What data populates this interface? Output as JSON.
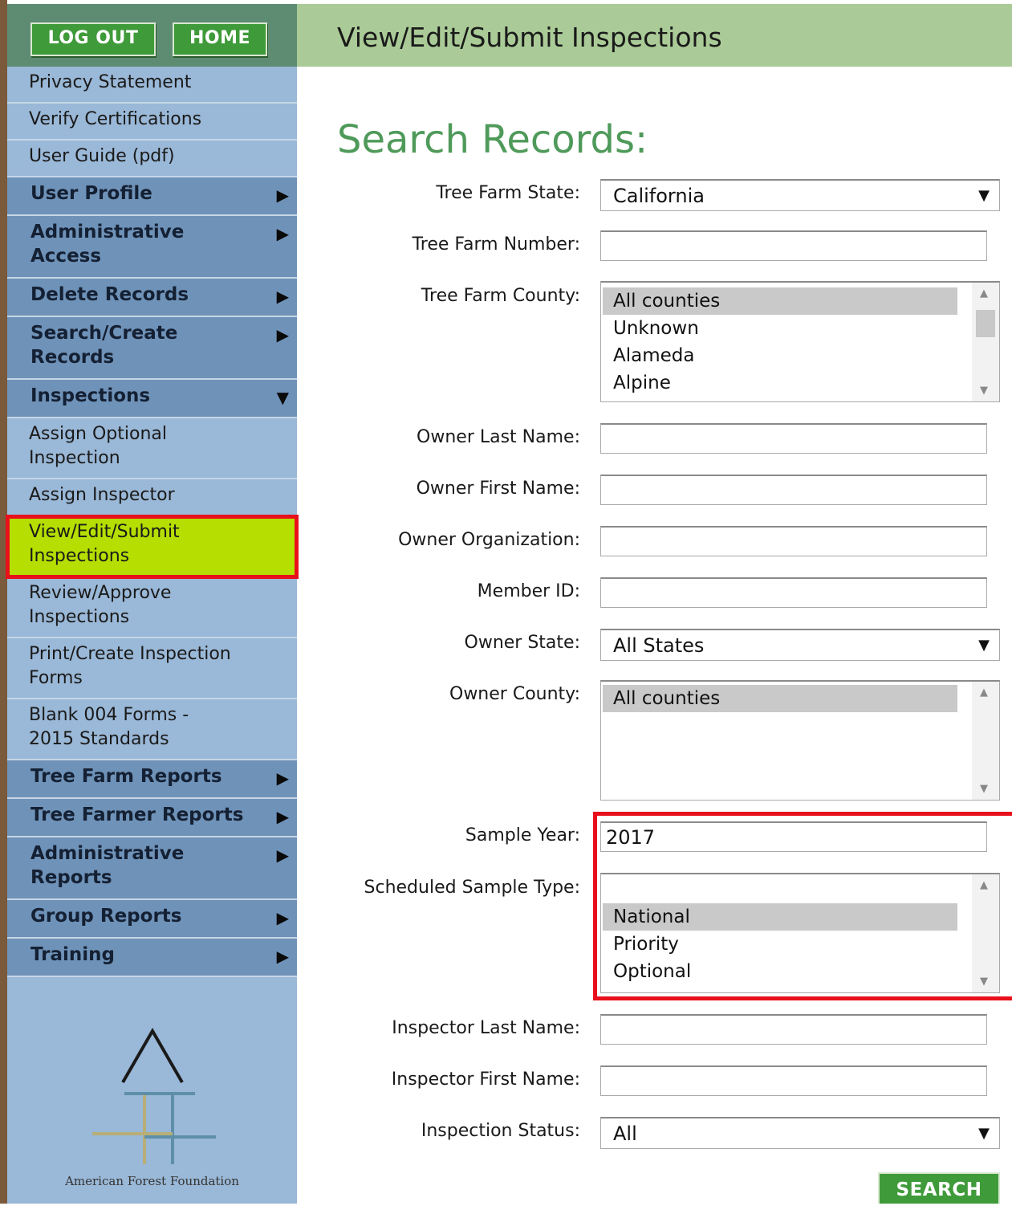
{
  "topbar": {
    "logout_label": "LOG OUT",
    "home_label": "HOME"
  },
  "header": {
    "title": "View/Edit/Submit Inspections"
  },
  "sidebar": {
    "links": [
      "Privacy Statement",
      "Verify Certifications",
      "User Guide (pdf)"
    ],
    "categories": {
      "user_profile": "User Profile",
      "administrative_access": [
        "Administrative",
        "Access"
      ],
      "delete_records": "Delete Records",
      "search_create": [
        "Search/Create",
        "Records"
      ],
      "inspections": "Inspections",
      "tree_farm_reports": "Tree Farm Reports",
      "tree_farmer_reports": "Tree Farmer Reports",
      "administrative_reports": [
        "Administrative",
        "Reports"
      ],
      "group_reports": "Group Reports",
      "training": "Training"
    },
    "arrows": {
      "collapsed": "▶",
      "expanded": "▼"
    },
    "inspection_items": {
      "assign_optional": [
        "Assign Optional",
        "Inspection"
      ],
      "assign_inspector": "Assign Inspector",
      "view_edit_submit": [
        "View/Edit/Submit",
        "Inspections"
      ],
      "review_approve": [
        "Review/Approve",
        "Inspections"
      ],
      "print_create": [
        "Print/Create Inspection",
        "Forms"
      ],
      "blank_forms": [
        "Blank 004 Forms -",
        "2015 Standards"
      ]
    },
    "logo": {
      "text": "American Forest Foundation",
      "colors": {
        "gold": "#b8ae78",
        "teal": "#5e8fa8",
        "letter": "#1a1a1a"
      }
    }
  },
  "form": {
    "heading": "Search Records:",
    "labels": {
      "tree_farm_state": "Tree Farm State:",
      "tree_farm_number": "Tree Farm Number:",
      "tree_farm_county": "Tree Farm County:",
      "owner_last_name": "Owner Last Name:",
      "owner_first_name": "Owner First Name:",
      "owner_organization": "Owner Organization:",
      "member_id": "Member ID:",
      "owner_state": "Owner State:",
      "owner_county": "Owner County:",
      "sample_year": "Sample Year:",
      "scheduled_sample_type": "Scheduled Sample Type:",
      "inspector_last_name": "Inspector Last Name:",
      "inspector_first_name": "Inspector First Name:",
      "inspection_status": "Inspection Status:"
    },
    "values": {
      "tree_farm_state": "California",
      "tree_farm_number": "",
      "owner_last_name": "",
      "owner_first_name": "",
      "owner_organization": "",
      "member_id": "",
      "owner_state": "All States",
      "sample_year": "2017",
      "inspector_last_name": "",
      "inspector_first_name": "",
      "inspection_status": "All"
    },
    "tree_farm_county_options": [
      "All counties",
      "Unknown",
      "Alameda",
      "Alpine"
    ],
    "owner_county_options": [
      "All counties"
    ],
    "sample_type_options": [
      "National",
      "Priority",
      "Optional"
    ],
    "search_label": "SEARCH",
    "select_caret": "▼"
  },
  "colors": {
    "highlight": "#b6de00",
    "annotation_red": "#e8101a",
    "header_green": "#aacb97",
    "heading_green": "#4f9a5a",
    "sidebar_blue": "#9ab8d7",
    "category_blue": "#6f92b8"
  }
}
